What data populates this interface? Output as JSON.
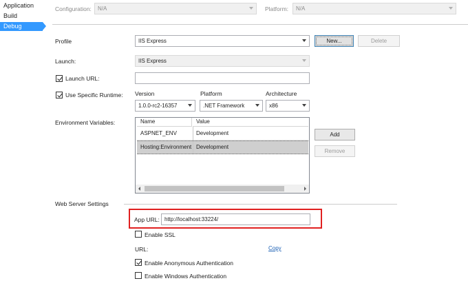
{
  "nav": {
    "items": [
      {
        "label": "Application",
        "selected": false
      },
      {
        "label": "Build",
        "selected": false
      },
      {
        "label": "Debug",
        "selected": true
      }
    ]
  },
  "toolbar": {
    "configuration_label": "Configuration:",
    "configuration_value": "N/A",
    "platform_label": "Platform:",
    "platform_value": "N/A"
  },
  "profile": {
    "label": "Profile",
    "value": "IIS Express",
    "new_button": "New...",
    "delete_button": "Delete"
  },
  "launch": {
    "label": "Launch:",
    "value": "IIS Express"
  },
  "launch_url": {
    "label": "Launch URL:",
    "checked": true,
    "value": ""
  },
  "runtime": {
    "label": "Use Specific Runtime:",
    "checked": true,
    "version_header": "Version",
    "version_value": "1.0.0-rc2-16357",
    "platform_header": "Platform",
    "platform_value": ".NET Framework",
    "architecture_header": "Architecture",
    "architecture_value": "x86"
  },
  "env": {
    "label": "Environment Variables:",
    "columns": [
      "Name",
      "Value"
    ],
    "rows": [
      {
        "name": "ASPNET_ENV",
        "value": "Development"
      },
      {
        "name": "Hosting:Environment",
        "value": "Development"
      }
    ],
    "add_button": "Add",
    "remove_button": "Remove"
  },
  "web_server": {
    "section_label": "Web Server Settings",
    "app_url_label": "App URL:",
    "app_url_value": "http://localhost:33224/",
    "enable_ssl_label": "Enable SSL",
    "enable_ssl_checked": false,
    "url_label": "URL:",
    "copy_link": "Copy",
    "anon_auth_label": "Enable Anonymous Authentication",
    "anon_auth_checked": true,
    "windows_auth_label": "Enable Windows Authentication",
    "windows_auth_checked": false
  },
  "colors": {
    "accent": "#3399ff",
    "highlight_border": "#e02020",
    "link": "#1a5fb4"
  }
}
